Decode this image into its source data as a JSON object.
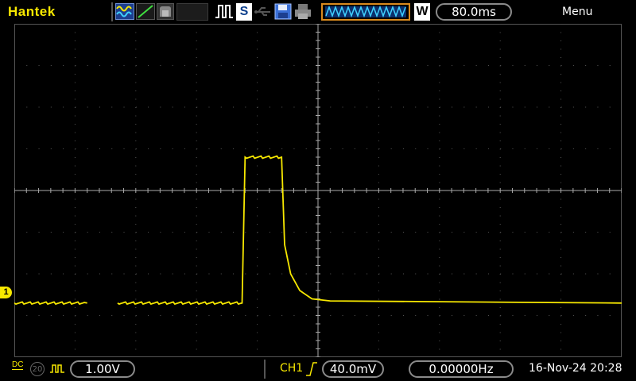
{
  "top_bar": {
    "brand": "Hantek",
    "status_badge": "S",
    "memory_mode_badge": "W",
    "timebase": "80.0ms",
    "menu_label": "Menu"
  },
  "screen": {
    "channel_marker": "1",
    "trace_color": "#f7e800",
    "grid_color": "#555555",
    "background": "#000000",
    "trace": {
      "type": "line",
      "x_div_range": [
        -5,
        5
      ],
      "y_div_range": [
        -4,
        4
      ],
      "points": [
        [
          -5.0,
          -2.7
        ],
        [
          -3.8,
          -2.7
        ],
        [
          -3.3,
          -2.7
        ],
        [
          -1.25,
          -2.7
        ],
        [
          -1.2,
          0.8
        ],
        [
          -0.6,
          0.8
        ],
        [
          -0.55,
          -1.3
        ],
        [
          -0.45,
          -2.0
        ],
        [
          -0.3,
          -2.4
        ],
        [
          -0.1,
          -2.6
        ],
        [
          0.2,
          -2.65
        ],
        [
          5.0,
          -2.7
        ]
      ],
      "gap_div": [
        -3.8,
        -3.3
      ]
    }
  },
  "bottom_bar": {
    "coupling_label": "DC",
    "bw_limit_label": "20",
    "ch1_volts_div": "1.00V",
    "trigger_source": "CH1",
    "trigger_level": "40.0mV",
    "frequency": "0.00000Hz",
    "datetime": "16-Nov-24 20:28"
  }
}
